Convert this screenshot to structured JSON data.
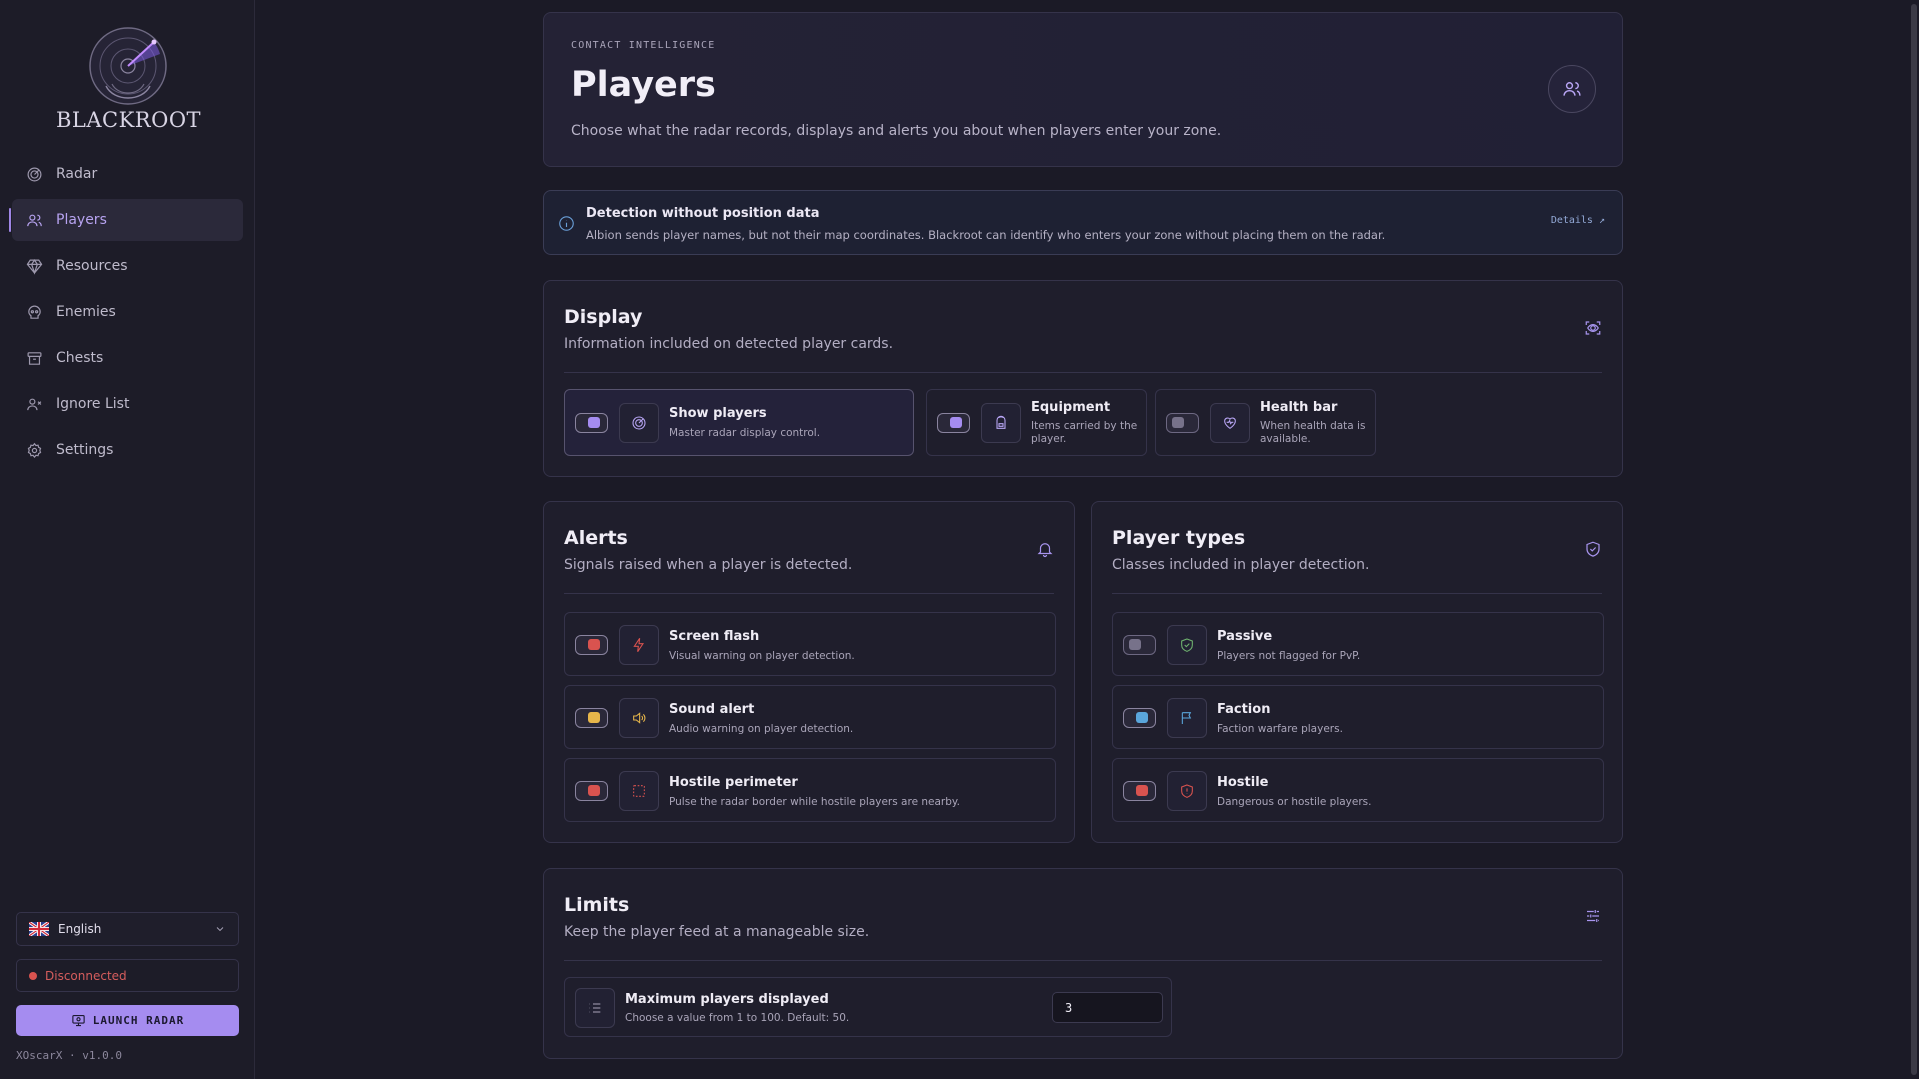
{
  "app": {
    "name": "BLACKROOT",
    "version": "XOscarX · v1.0.0"
  },
  "sidebar": {
    "items": [
      {
        "label": "Radar",
        "icon": "radar-icon",
        "active": false
      },
      {
        "label": "Players",
        "icon": "users-icon",
        "active": true
      },
      {
        "label": "Resources",
        "icon": "gem-icon",
        "active": false
      },
      {
        "label": "Enemies",
        "icon": "skull-icon",
        "active": false
      },
      {
        "label": "Chests",
        "icon": "archive-icon",
        "active": false
      },
      {
        "label": "Ignore List",
        "icon": "user-x-icon",
        "active": false
      },
      {
        "label": "Settings",
        "icon": "gear-icon",
        "active": false
      }
    ],
    "language": "English",
    "status": "Disconnected",
    "launch_label": "LAUNCH RADAR"
  },
  "hero": {
    "eyebrow": "CONTACT INTELLIGENCE",
    "title": "Players",
    "description": "Choose what the radar records, displays and alerts you about when players enter your zone."
  },
  "notice": {
    "title": "Detection without position data",
    "description": "Albion sends player names, but not their map coordinates. Blackroot can identify who enters your zone without placing them on the radar.",
    "link": "Details ↗"
  },
  "display": {
    "title": "Display",
    "description": "Information included on detected player cards.",
    "options": [
      {
        "label": "Show players",
        "desc": "Master radar display control.",
        "enabled": true,
        "color": "#a58cf0"
      },
      {
        "label": "Equipment",
        "desc": "Items carried by the player.",
        "enabled": true,
        "color": "#a58cf0"
      },
      {
        "label": "Health bar",
        "desc": "When health data is available.",
        "enabled": false,
        "color": "#77728a"
      }
    ]
  },
  "alerts": {
    "title": "Alerts",
    "description": "Signals raised when a player is detected.",
    "options": [
      {
        "label": "Screen flash",
        "desc": "Visual warning on player detection.",
        "enabled": true,
        "color": "#d9534f"
      },
      {
        "label": "Sound alert",
        "desc": "Audio warning on player detection.",
        "enabled": true,
        "color": "#e7b64a"
      },
      {
        "label": "Hostile perimeter",
        "desc": "Pulse the radar border while hostile players are nearby.",
        "enabled": true,
        "color": "#d9534f"
      }
    ]
  },
  "player_types": {
    "title": "Player types",
    "description": "Classes included in player detection.",
    "options": [
      {
        "label": "Passive",
        "desc": "Players not flagged for PvP.",
        "enabled": false,
        "color": "#77728a"
      },
      {
        "label": "Faction",
        "desc": "Faction warfare players.",
        "enabled": true,
        "color": "#5aa6dc"
      },
      {
        "label": "Hostile",
        "desc": "Dangerous or hostile players.",
        "enabled": true,
        "color": "#d9534f"
      }
    ]
  },
  "limits": {
    "title": "Limits",
    "description": "Keep the player feed at a manageable size.",
    "max_players": {
      "label": "Maximum players displayed",
      "desc": "Choose a value from 1 to 100. Default: 50.",
      "value": "3"
    }
  },
  "colors": {
    "accent": "#a58cf0",
    "danger": "#d9534f",
    "warning": "#e7b64a",
    "info": "#5aa6dc",
    "passive": "#6fb36f"
  }
}
